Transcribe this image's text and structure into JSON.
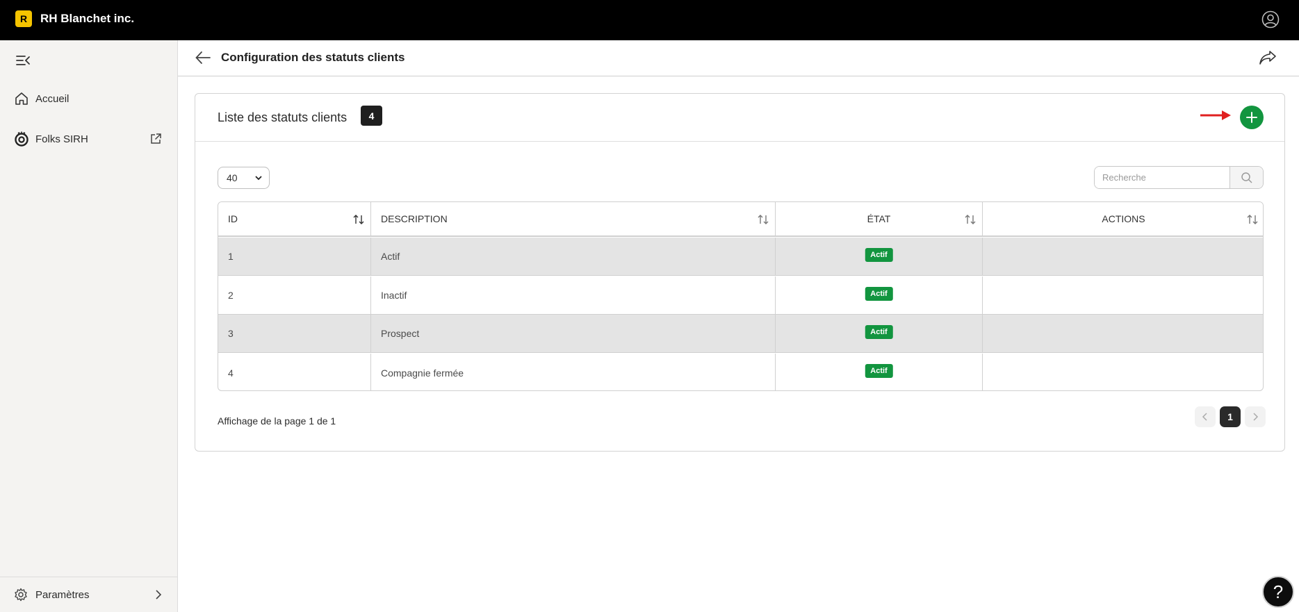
{
  "topbar": {
    "logo_letter": "R",
    "brand": "RH Blanchet inc.",
    "logo_color": "#f5c400"
  },
  "sidebar": {
    "items": [
      {
        "label": "Accueil",
        "icon": "home-icon"
      },
      {
        "label": "Folks SIRH",
        "icon": "folks-icon",
        "external": true
      }
    ],
    "bottom": {
      "label": "Paramètres",
      "icon": "gear-icon"
    }
  },
  "header": {
    "title": "Configuration des statuts clients"
  },
  "card": {
    "title": "Liste des statuts clients",
    "count": "4",
    "page_size": "40",
    "search_placeholder": "Recherche",
    "accent": "#12953f"
  },
  "table": {
    "headers": [
      "ID",
      "DESCRIPTION",
      "ÉTAT",
      "ACTIONS"
    ],
    "rows": [
      {
        "id": "1",
        "description": "Actif",
        "state": "Actif"
      },
      {
        "id": "2",
        "description": "Inactif",
        "state": "Actif"
      },
      {
        "id": "3",
        "description": "Prospect",
        "state": "Actif"
      },
      {
        "id": "4",
        "description": "Compagnie fermée",
        "state": "Actif"
      }
    ]
  },
  "pagination": {
    "info": "Affichage de la page 1 de 1",
    "current": "1"
  },
  "help": {
    "label": "?"
  }
}
